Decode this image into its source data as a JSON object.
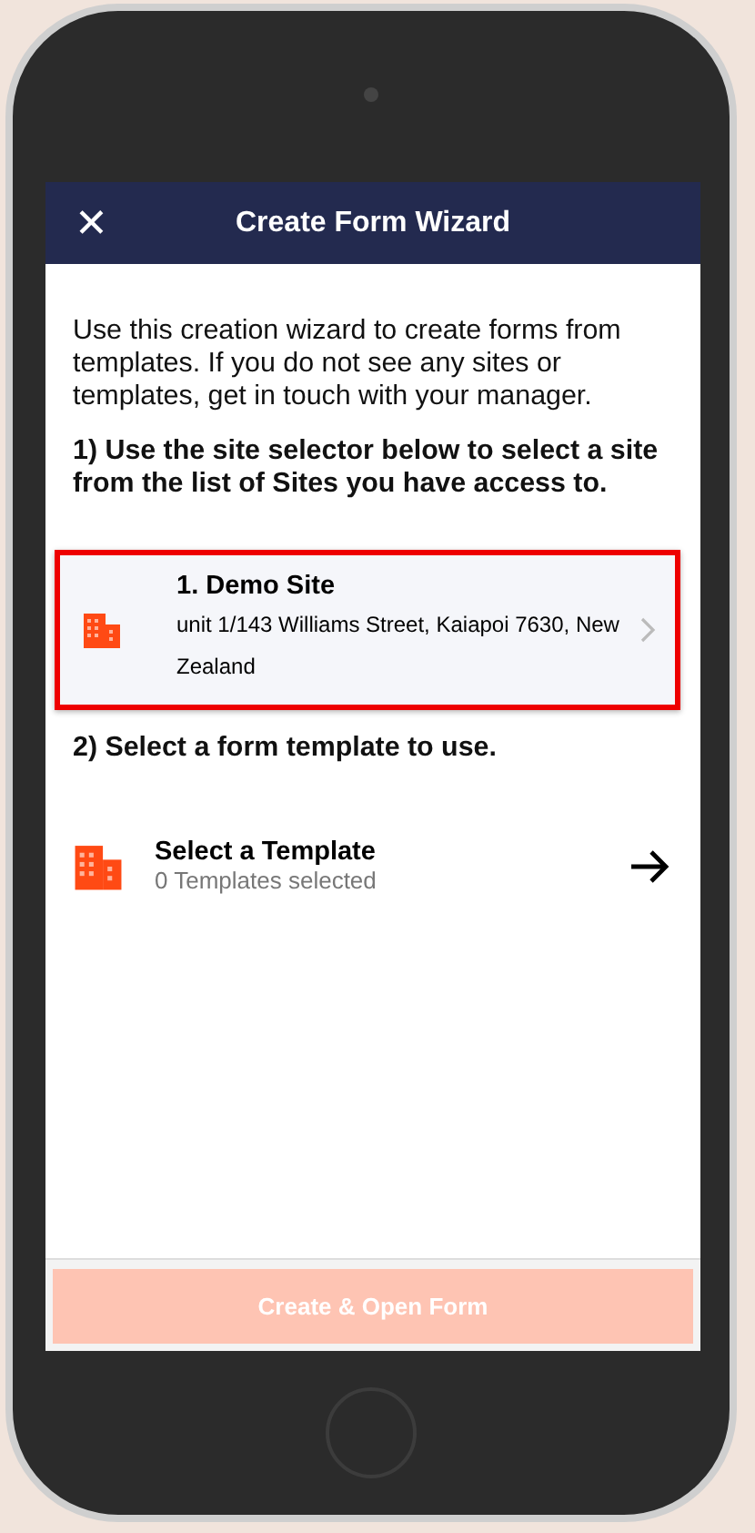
{
  "header": {
    "close_icon": "✕",
    "title": "Create Form Wizard"
  },
  "intro": "Use this creation wizard to create forms from templates. If you do not see any sites or templates, get in touch with your manager.",
  "step_1": "1) Use the site selector below to select a site from the list of Sites you have access to.",
  "site": {
    "name": "1. Demo Site",
    "address": "unit 1/143 Williams Street, Kaiapoi 7630, New Zealand",
    "highlighted": true
  },
  "step_2": "2) Select a form template to use.",
  "template": {
    "title": "Select a Template",
    "subtitle": "0 Templates selected"
  },
  "create_button": {
    "label": "Create & Open Form",
    "disabled": true
  }
}
